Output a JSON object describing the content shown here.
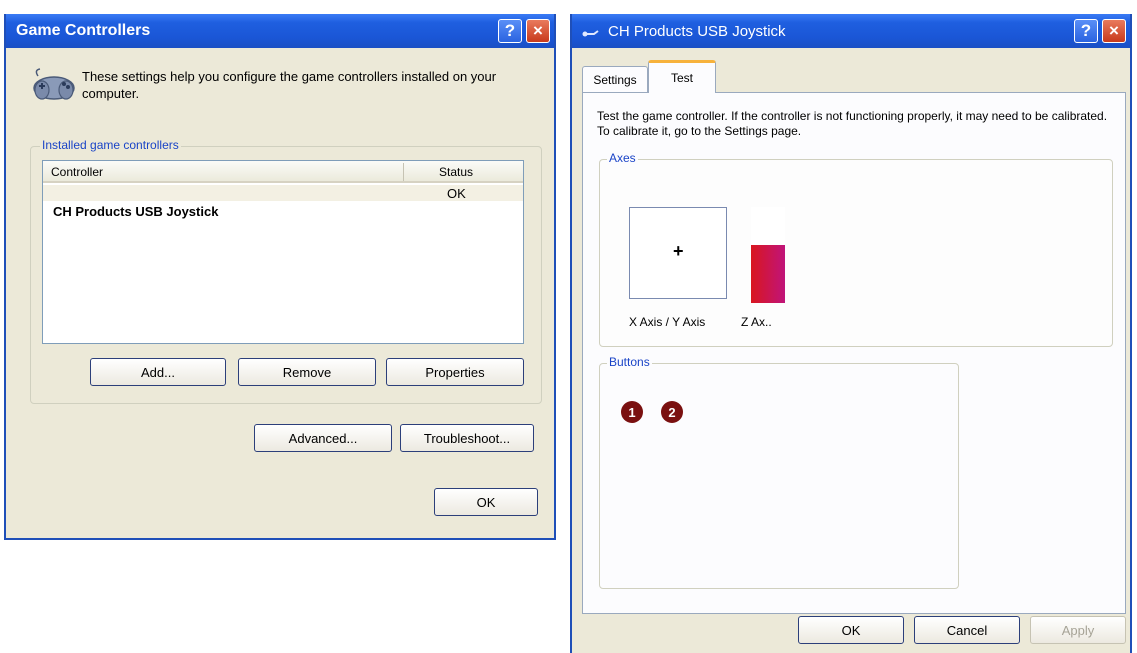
{
  "game_controllers": {
    "title": "Game Controllers",
    "description": "These settings help you configure the game controllers installed on your computer.",
    "group_label": "Installed game controllers",
    "columns": {
      "controller": "Controller",
      "status": "Status"
    },
    "rows": [
      {
        "controller": "CH Products USB Joystick",
        "status": "OK"
      }
    ],
    "buttons": {
      "add": "Add...",
      "remove": "Remove",
      "properties": "Properties",
      "advanced": "Advanced...",
      "troubleshoot": "Troubleshoot...",
      "ok": "OK"
    }
  },
  "joystick": {
    "title": "CH Products USB Joystick",
    "tabs": [
      "Settings",
      "Test"
    ],
    "active_tab": "Test",
    "instructions": "Test the game controller.  If the controller is not functioning properly, it may need to be calibrated.  To calibrate it, go to the Settings page.",
    "axes_label": "Axes",
    "xy_axis_label": "X Axis / Y Axis",
    "z_axis_label": "Z Ax..",
    "z_axis_level": 0.6,
    "buttons_label": "Buttons",
    "button_numbers": [
      "1",
      "2"
    ],
    "footer": {
      "ok": "OK",
      "cancel": "Cancel",
      "apply": "Apply"
    }
  },
  "title_buttons": {
    "help": "?",
    "close": "×"
  },
  "crosshair": "+",
  "colors": {
    "title_bar": "#1f5fe0",
    "button_led": "#7a1010",
    "z_axis_bar": "#d9161f",
    "group_label": "#1a44c7"
  }
}
